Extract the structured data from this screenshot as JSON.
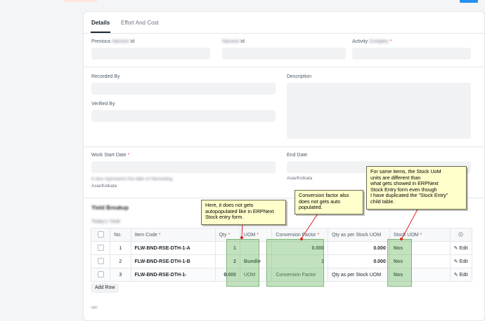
{
  "tabs": [
    "Details",
    "Effort And Cost"
  ],
  "fields": {
    "previous_prefix": "Previous",
    "previous_blur": "Harvest",
    "previous_suffix": "Id",
    "harvest_blur": "Harvest",
    "harvest_suffix": "Id",
    "activity_prefix": "Activity",
    "activity_blur": "Complex",
    "recorded_by": "Recorded By",
    "verified_by": "Verified By",
    "description": "Description",
    "work_start_date": "Work Start Date",
    "work_start_hint": "It also represents the date of Harvesting",
    "work_start_tz": "Asia/Kolkata",
    "end_date": "End Date",
    "end_tz": "Asia/Kolkata",
    "required_mark": "*"
  },
  "section": {
    "title": "Yield Breakup",
    "table_label": "Today's Yield"
  },
  "table": {
    "headers": [
      "No.",
      "Item Code",
      "Qty",
      "UOM",
      "Conversion Factor",
      "Qty as per Stock UOM",
      "Stock UOM"
    ],
    "rows": [
      {
        "no": "1",
        "item_code": "FLW-BND-RSE-DTH-1-A",
        "qty": "1",
        "uom": "",
        "conversion_factor": "0.000",
        "stock_qty": "0.000",
        "stock_uom": "Nos",
        "edit": "Edit"
      },
      {
        "no": "2",
        "item_code": "FLW-BND-RSE-DTH-1-B",
        "qty": "2",
        "uom": "Bundle",
        "conversion_factor": "1",
        "stock_qty": "0.000",
        "stock_uom": "Nos",
        "edit": "Edit"
      },
      {
        "no": "3",
        "item_code": "FLW-BND-RSE-DTH-1-",
        "qty": "0.000",
        "uom": "UOM",
        "conversion_factor": "Conversion Factor",
        "stock_qty": "Qty as per Stock UOM",
        "stock_uom": "Nos",
        "edit": "Edit"
      }
    ],
    "add_row": "Add Row"
  },
  "annotations": {
    "uom_note": "Here, it does not gets\nautopopulated like in ERPNext\nStock entry form.",
    "cf_note": "Conversion factor also\ndoes not gets auto\npopulated.",
    "stock_uom_note": "For same items, the Stock UoM\n units are different than\nwhat gets showed in ERPNext\nStock Entry form even though\n I have duplicated the \"Stock Entry\"\nchild table."
  },
  "icons": {
    "settings": "gear-icon",
    "edit": "pencil-icon"
  },
  "colors": {
    "primary": "#2490ef",
    "highlight": "#78be6e",
    "note_bg": "#ffffcc",
    "required": "#e24c4c"
  }
}
